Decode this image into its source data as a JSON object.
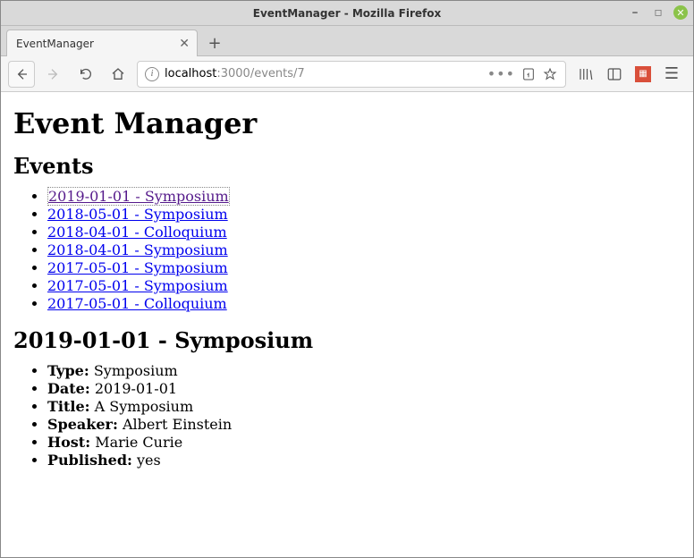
{
  "window": {
    "title": "EventManager - Mozilla Firefox"
  },
  "tab": {
    "label": "EventManager"
  },
  "url": {
    "host": "localhost",
    "path": ":3000/events/7"
  },
  "page": {
    "heading": "Event Manager",
    "events_heading": "Events",
    "events": [
      {
        "label": "2019-01-01 - Symposium",
        "visited": true,
        "selected": true
      },
      {
        "label": "2018-05-01 - Symposium",
        "visited": false,
        "selected": false
      },
      {
        "label": "2018-04-01 - Colloquium",
        "visited": false,
        "selected": false
      },
      {
        "label": "2018-04-01 - Symposium",
        "visited": false,
        "selected": false
      },
      {
        "label": "2017-05-01 - Symposium",
        "visited": false,
        "selected": false
      },
      {
        "label": "2017-05-01 - Symposium",
        "visited": false,
        "selected": false
      },
      {
        "label": "2017-05-01 - Colloquium",
        "visited": false,
        "selected": false
      }
    ],
    "detail_heading": "2019-01-01 - Symposium",
    "detail": {
      "type_label": "Type:",
      "type_value": "Symposium",
      "date_label": "Date:",
      "date_value": "2019-01-01",
      "title_label": "Title:",
      "title_value": "A Symposium",
      "speaker_label": "Speaker:",
      "speaker_value": "Albert Einstein",
      "host_label": "Host:",
      "host_value": "Marie Curie",
      "published_label": "Published:",
      "published_value": "yes"
    }
  }
}
